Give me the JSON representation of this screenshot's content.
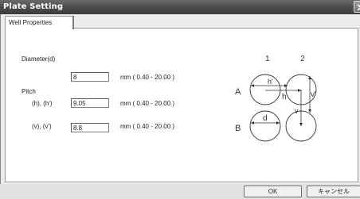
{
  "window": {
    "title": "Plate Setting"
  },
  "tabs": [
    {
      "label": "Well Properties"
    }
  ],
  "form": {
    "diameter": {
      "label": "Diameter(d)",
      "value": "8",
      "range": "mm ( 0.40 - 20.00 )"
    },
    "pitch": {
      "label": "Pitch",
      "h": {
        "label": "(h),  (h')",
        "value": "9.05",
        "range": "mm ( 0.40 - 20.00 )"
      },
      "v": {
        "label": "(v),  (v')",
        "value": "8.8",
        "range": "mm ( 0.40 - 20.00 )"
      }
    }
  },
  "diagram": {
    "col1": "1",
    "col2": "2",
    "rowA": "A",
    "rowB": "B",
    "h_prime": "h'",
    "h": "h",
    "v_prime": "v'",
    "v": "v",
    "d": "d"
  },
  "buttons": {
    "ok": "OK",
    "cancel": "キャンセル"
  }
}
